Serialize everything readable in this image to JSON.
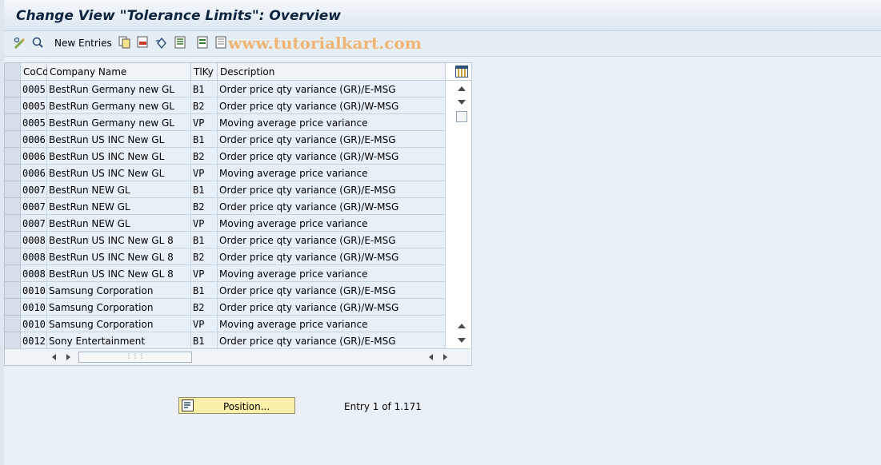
{
  "header": {
    "title": "Change View \"Tolerance Limits\": Overview"
  },
  "toolbar": {
    "new_entries_label": "New Entries",
    "watermark": "www.tutorialkart.com"
  },
  "table": {
    "columns": [
      "CoCd",
      "Company Name",
      "TlKy",
      "Description"
    ],
    "rows": [
      [
        "0005",
        "BestRun Germany new GL",
        "B1",
        "Order price qty variance (GR)/E-MSG"
      ],
      [
        "0005",
        "BestRun Germany new GL",
        "B2",
        "Order price qty variance (GR)/W-MSG"
      ],
      [
        "0005",
        "BestRun Germany new GL",
        "VP",
        "Moving average price variance"
      ],
      [
        "0006",
        "BestRun US INC New GL",
        "B1",
        "Order price qty variance (GR)/E-MSG"
      ],
      [
        "0006",
        "BestRun US INC New GL",
        "B2",
        "Order price qty variance (GR)/W-MSG"
      ],
      [
        "0006",
        "BestRun US INC New GL",
        "VP",
        "Moving average price variance"
      ],
      [
        "0007",
        "BestRun NEW GL",
        "B1",
        "Order price qty variance (GR)/E-MSG"
      ],
      [
        "0007",
        "BestRun NEW GL",
        "B2",
        "Order price qty variance (GR)/W-MSG"
      ],
      [
        "0007",
        "BestRun NEW GL",
        "VP",
        "Moving average price variance"
      ],
      [
        "0008",
        "BestRun US INC New GL 8",
        "B1",
        "Order price qty variance (GR)/E-MSG"
      ],
      [
        "0008",
        "BestRun US INC New GL 8",
        "B2",
        "Order price qty variance (GR)/W-MSG"
      ],
      [
        "0008",
        "BestRun US INC New GL 8",
        "VP",
        "Moving average price variance"
      ],
      [
        "0010",
        "Samsung Corporation",
        "B1",
        "Order price qty variance (GR)/E-MSG"
      ],
      [
        "0010",
        "Samsung Corporation",
        "B2",
        "Order price qty variance (GR)/W-MSG"
      ],
      [
        "0010",
        "Samsung Corporation",
        "VP",
        "Moving average price variance"
      ],
      [
        "0012",
        "Sony Entertainment",
        "B1",
        "Order price qty variance (GR)/E-MSG"
      ]
    ]
  },
  "footer": {
    "position_label": "Position...",
    "entry_text": "Entry 1 of 1.171"
  },
  "icons": [
    "edit-glasses-icon",
    "details-icon",
    "copy-icon",
    "delete-icon",
    "undo-icon",
    "select-all-icon",
    "select-block-icon",
    "deselect-all-icon",
    "column-settings-icon",
    "position-icon"
  ]
}
